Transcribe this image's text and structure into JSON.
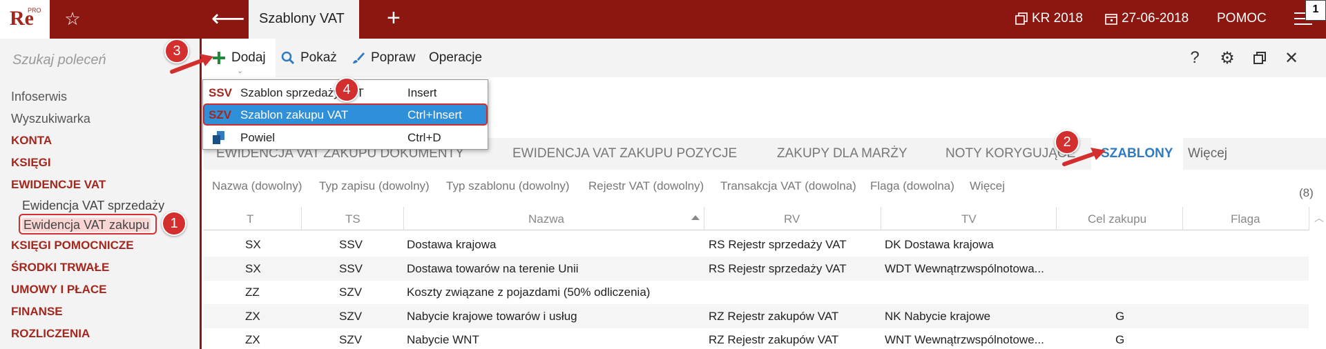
{
  "app": {
    "logo_text": "Re",
    "logo_sup": "PRO",
    "tab_title": "Szablony VAT",
    "year_label": "KR 2018",
    "date_label": "27-06-2018",
    "help_label": "POMOC",
    "corner_badge": "1"
  },
  "sidebar": {
    "search_placeholder": "Szukaj poleceń",
    "items": [
      {
        "label": "Infoserwis"
      },
      {
        "label": "Wyszukiwarka"
      },
      {
        "label": "KONTA"
      },
      {
        "label": "KSIĘGI"
      },
      {
        "label": "EWIDENCJE VAT"
      },
      {
        "label": "Ewidencja VAT sprzedaży"
      },
      {
        "label": "Ewidencja VAT zakupu"
      },
      {
        "label": "KSIĘGI POMOCNICZE"
      },
      {
        "label": "ŚRODKI TRWAŁE"
      },
      {
        "label": "UMOWY I PŁACE"
      },
      {
        "label": "FINANSE"
      },
      {
        "label": "ROZLICZENIA"
      }
    ]
  },
  "toolbar": {
    "add_label": "Dodaj",
    "show_label": "Pokaż",
    "edit_label": "Popraw",
    "ops_label": "Operacje"
  },
  "dropdown": {
    "items": [
      {
        "code": "SSV",
        "label": "Szablon sprzedaży VAT",
        "shortcut": "Insert"
      },
      {
        "code": "SZV",
        "label": "Szablon zakupu VAT",
        "shortcut": "Ctrl+Insert"
      },
      {
        "code": "",
        "label": "Powiel",
        "shortcut": "Ctrl+D"
      }
    ]
  },
  "tabs": {
    "items": [
      {
        "label": "EWIDENCJA VAT ZAKUPU DOKUMENTY"
      },
      {
        "label": "EWIDENCJA VAT ZAKUPU POZYCJE"
      },
      {
        "label": "ZAKUPY DLA MARŻY"
      },
      {
        "label": "NOTY KORYGUJĄCE"
      },
      {
        "label": "SZABLONY"
      },
      {
        "label": "Więcej"
      }
    ]
  },
  "filters": {
    "items": [
      {
        "label": "Nazwa (dowolny)"
      },
      {
        "label": "Typ zapisu (dowolny)"
      },
      {
        "label": "Typ szablonu (dowolny)"
      },
      {
        "label": "Rejestr VAT (dowolny)"
      },
      {
        "label": "Transakcja VAT (dowolna)"
      },
      {
        "label": "Flaga (dowolna)"
      },
      {
        "label": "Więcej"
      }
    ],
    "count": "(8)"
  },
  "table": {
    "headers": [
      "T",
      "TS",
      "Nazwa",
      "RV",
      "TV",
      "Cel zakupu",
      "Flaga"
    ],
    "rows": [
      {
        "t": "SX",
        "ts": "SSV",
        "nazwa": "Dostawa krajowa",
        "rv": "RS Rejestr sprzedaży VAT",
        "tv": "DK Dostawa krajowa",
        "cel": "",
        "flaga": ""
      },
      {
        "t": "SX",
        "ts": "SSV",
        "nazwa": "Dostawa towarów na terenie Unii",
        "rv": "RS Rejestr sprzedaży VAT",
        "tv": "WDT Wewnątrzwspólnotowa...",
        "cel": "",
        "flaga": ""
      },
      {
        "t": "ZZ",
        "ts": "SZV",
        "nazwa": "Koszty związane z pojazdami (50% odliczenia)",
        "rv": "",
        "tv": "",
        "cel": "",
        "flaga": ""
      },
      {
        "t": "ZX",
        "ts": "SZV",
        "nazwa": "Nabycie krajowe towarów i usług",
        "rv": "RZ Rejestr zakupów VAT",
        "tv": "NK Nabycie krajowe",
        "cel": "G",
        "flaga": ""
      },
      {
        "t": "ZX",
        "ts": "SZV",
        "nazwa": "Nabycie WNT",
        "rv": "RZ Rejestr zakupów VAT",
        "tv": "WNT Wewnątrzwspólnotowe...",
        "cel": "G",
        "flaga": ""
      }
    ]
  },
  "callouts": {
    "c1": "1",
    "c2": "2",
    "c3": "3",
    "c4": "4"
  },
  "colors": {
    "brand": "#8c1710",
    "accent_blue": "#2f7bc1",
    "highlight": "#2f8fd8",
    "callout": "#d32f2f"
  }
}
